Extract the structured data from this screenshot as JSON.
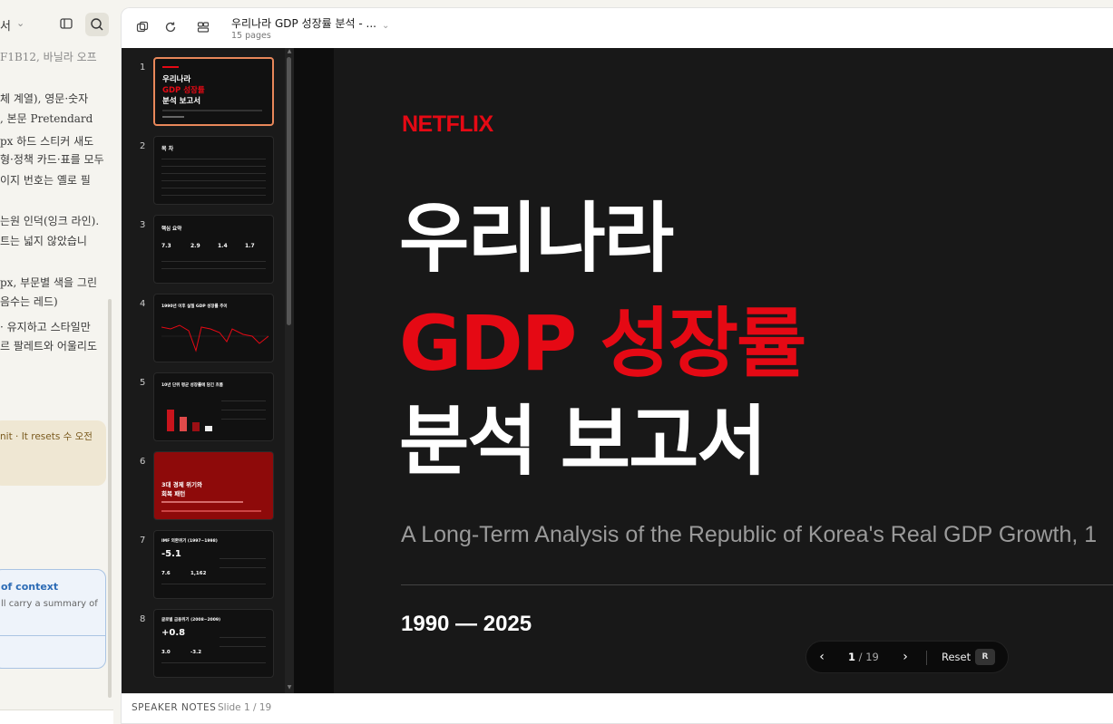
{
  "chat_panel": {
    "title_fragment": "서",
    "lines": [
      "F1B12, 바닐라 오프",
      "체 계열), 영문·숫자",
      ", 본문 Pretendard",
      "px 하드 스티커 새도",
      "형·정책 카드·표를 모두",
      "이지 번호는 옐로 필",
      "",
      "는원 인덕(잉크 라인).",
      "트는 넓지 않았습니",
      "",
      "px, 부문별 색을 그린",
      "음수는 레드)",
      "· 유지하고 스타일만",
      "르 팔레트와 어울리도"
    ],
    "limit_notice": "nit · It resets 수 오전",
    "context_title": "of context",
    "context_desc": "ll carry a summary of"
  },
  "viewer": {
    "title": "우리나라 GDP 성장률 분석 - ...",
    "pages": "15 pages",
    "thumbnails": [
      {
        "num": "1",
        "title1": "우리나라",
        "title2": "GDP 성장률",
        "title3": "분석 보고서"
      },
      {
        "num": "2",
        "title1": "목 차"
      },
      {
        "num": "3",
        "title1": "핵심 요약",
        "stats": [
          "7.3",
          "2.9",
          "1.4",
          "1.7"
        ]
      },
      {
        "num": "4",
        "title1": "1990년 이후 실질 GDP 성장률 추이"
      },
      {
        "num": "5",
        "title1": "10년 단위 평균 성장률에 담긴 흐름"
      },
      {
        "num": "6",
        "title1": "3대 경제 위기와",
        "title2": "회복 패턴"
      },
      {
        "num": "7",
        "title1": "IMF 외환위기 (1997~1998)",
        "big": "-5.1",
        "stats": [
          "7.6",
          "1,162"
        ]
      },
      {
        "num": "8",
        "title1": "글로벌 금융위기 (2008~2009)",
        "big": "+0.8",
        "stats": [
          "3.0",
          "-3.2"
        ]
      }
    ],
    "slide": {
      "logo": "NETFLIX",
      "title_line1": "우리나라",
      "title_line2": "GDP 성장률",
      "title_line3": "분석 보고서",
      "subtitle": "A Long-Term Analysis of the Republic of Korea's Real GDP Growth, 1",
      "years": "1990 — 2025"
    },
    "nav": {
      "current": "1",
      "total": "/ 19",
      "reset_label": "Reset",
      "reset_key": "R"
    },
    "notes": {
      "label": "SPEAKER NOTES",
      "slide": "Slide 1 / 19"
    }
  },
  "colors": {
    "netflix_red": "#e50914",
    "slide_bg": "#181818",
    "active_thumb_border": "#e8875a"
  }
}
